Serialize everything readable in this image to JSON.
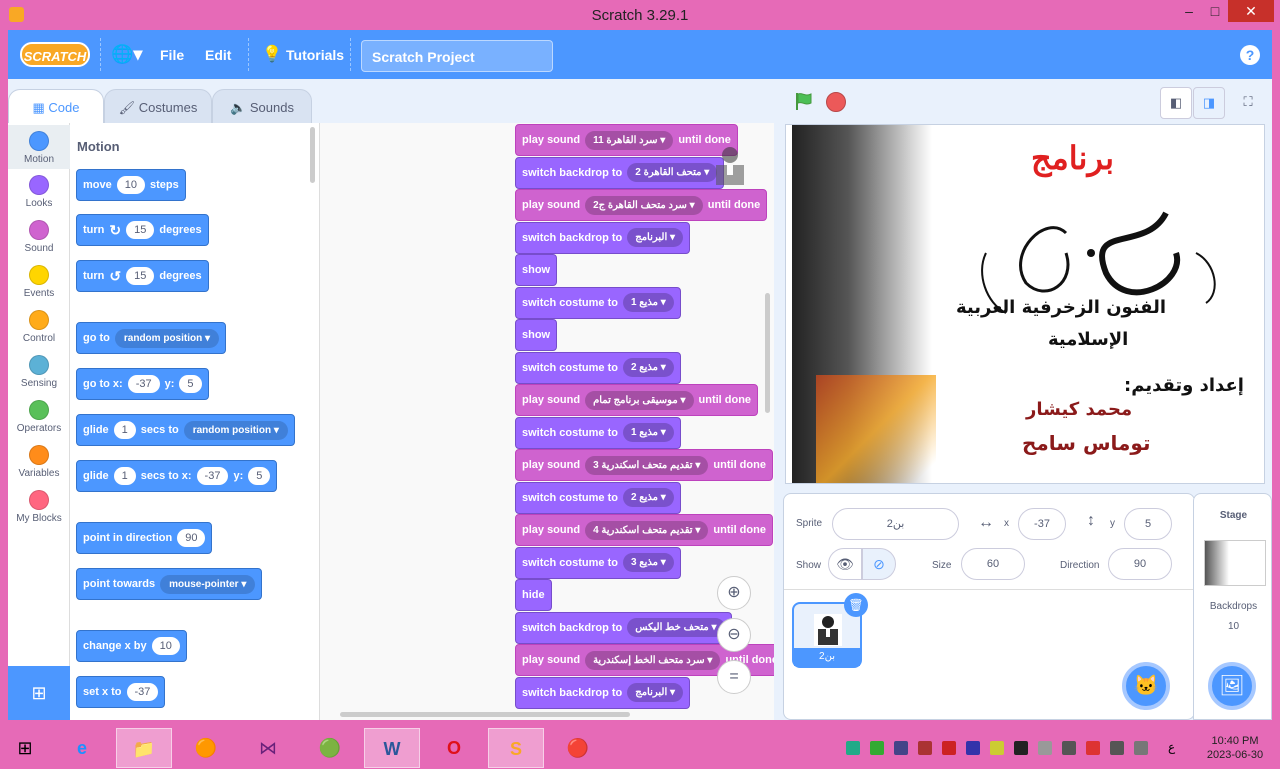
{
  "window": {
    "title": "Scratch 3.29.1",
    "min": "–",
    "max": "□",
    "close": "✕"
  },
  "menu": {
    "logo": "SCRATCH",
    "file": "File",
    "edit": "Edit",
    "tutorials": "Tutorials",
    "project_title": "Scratch Project",
    "help": "?"
  },
  "tabs": {
    "code": "Code",
    "costumes": "Costumes",
    "sounds": "Sounds"
  },
  "categories": [
    {
      "label": "Motion",
      "color": "#4c97ff"
    },
    {
      "label": "Looks",
      "color": "#9966ff"
    },
    {
      "label": "Sound",
      "color": "#cf63cf"
    },
    {
      "label": "Events",
      "color": "#ffd500"
    },
    {
      "label": "Control",
      "color": "#ffab19"
    },
    {
      "label": "Sensing",
      "color": "#5cb1d6"
    },
    {
      "label": "Operators",
      "color": "#59c059"
    },
    {
      "label": "Variables",
      "color": "#ff8c1a"
    },
    {
      "label": "My Blocks",
      "color": "#ff6680"
    }
  ],
  "palette": {
    "title": "Motion",
    "move": {
      "a": "move",
      "v": "10",
      "b": "steps"
    },
    "turn_r": {
      "a": "turn",
      "icon": "↻",
      "v": "15",
      "b": "degrees"
    },
    "turn_l": {
      "a": "turn",
      "icon": "↺",
      "v": "15",
      "b": "degrees"
    },
    "goto": {
      "a": "go to",
      "d": "random position"
    },
    "gotoxy": {
      "a": "go to x:",
      "x": "-37",
      "b": "y:",
      "y": "5"
    },
    "glide1": {
      "a": "glide",
      "v": "1",
      "b": "secs to",
      "d": "random position"
    },
    "glide2": {
      "a": "glide",
      "v": "1",
      "b": "secs to x:",
      "x": "-37",
      "c": "y:",
      "y": "5"
    },
    "point_dir": {
      "a": "point in direction",
      "v": "90"
    },
    "point_tow": {
      "a": "point towards",
      "d": "mouse-pointer"
    },
    "changex": {
      "a": "change x by",
      "v": "10"
    },
    "setx": {
      "a": "set x to",
      "v": "-37"
    }
  },
  "script": [
    {
      "t": "sound",
      "a": "play sound",
      "d": "سرد القاهرة 11",
      "b": "until done"
    },
    {
      "t": "looks",
      "a": "switch backdrop to",
      "d": "متحف القاهرة 2"
    },
    {
      "t": "sound",
      "a": "play sound",
      "d": "سرد متحف القاهرة ج2",
      "b": "until done"
    },
    {
      "t": "looks",
      "a": "switch backdrop to",
      "d": "البرنامج"
    },
    {
      "t": "looks",
      "a": "show"
    },
    {
      "t": "looks",
      "a": "switch costume to",
      "d": "مذيع 1"
    },
    {
      "t": "looks",
      "a": "show"
    },
    {
      "t": "looks",
      "a": "switch costume to",
      "d": "مذيع 2"
    },
    {
      "t": "sound",
      "a": "play sound",
      "d": "موسيقى برنامج تمام",
      "b": "until done"
    },
    {
      "t": "looks",
      "a": "switch costume to",
      "d": "مذيع 1"
    },
    {
      "t": "sound",
      "a": "play sound",
      "d": "تقديم متحف اسكندرية 3",
      "b": "until done"
    },
    {
      "t": "looks",
      "a": "switch costume to",
      "d": "مذيع 2"
    },
    {
      "t": "sound",
      "a": "play sound",
      "d": "تقديم متحف اسكندرية 4",
      "b": "until done"
    },
    {
      "t": "looks",
      "a": "switch costume to",
      "d": "مذيع 3"
    },
    {
      "t": "looks",
      "a": "hide"
    },
    {
      "t": "looks",
      "a": "switch backdrop to",
      "d": "متحف خط اليكس"
    },
    {
      "t": "sound",
      "a": "play sound",
      "d": "سرد متحف الخط إسكندرية",
      "b": "until done"
    },
    {
      "t": "looks",
      "a": "switch backdrop to",
      "d": "البرنامج"
    }
  ],
  "stage_text": {
    "title": "برنامج",
    "subtitle1": "الفنون الزخرفية العربية",
    "subtitle2": "الإسلامية",
    "by": "إعداد وتقديم:",
    "name1": "محمد كيشار",
    "name2": "توماس سامح"
  },
  "sprite_info": {
    "sprite_label": "Sprite",
    "sprite_name": "بن2",
    "x_label": "x",
    "x": "-37",
    "y_label": "y",
    "y": "5",
    "show_label": "Show",
    "size_label": "Size",
    "size": "60",
    "direction_label": "Direction",
    "direction": "90",
    "tile_name": "بن2"
  },
  "stage_pane": {
    "title": "Stage",
    "backdrops_label": "Backdrops",
    "backdrops_count": "10"
  },
  "taskbar": {
    "time": "10:40 PM",
    "date": "2023-06-30",
    "lang": "ع"
  }
}
